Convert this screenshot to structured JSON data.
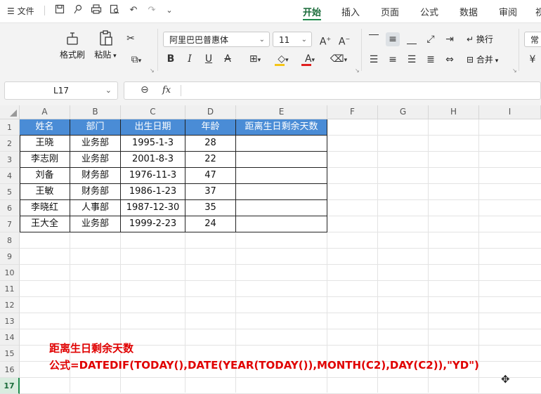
{
  "titlebar": {
    "file_menu": "文件",
    "tabs": [
      "开始",
      "插入",
      "页面",
      "公式",
      "数据",
      "审阅",
      "视"
    ]
  },
  "ribbon": {
    "format_painter": "格式刷",
    "paste": "粘贴",
    "font_name": "阿里巴巴普惠体",
    "font_size": "11",
    "wrap": "换行",
    "merge": "合并",
    "normal": "常",
    "font_color": "#e02020",
    "fill_color": "#f5c518"
  },
  "formula_bar": {
    "name_box": "L17",
    "fx": "fx",
    "formula": ""
  },
  "sheet": {
    "columns": [
      "A",
      "B",
      "C",
      "D",
      "E",
      "F",
      "G",
      "H",
      "I"
    ],
    "rows": [
      "1",
      "2",
      "3",
      "4",
      "5",
      "6",
      "7",
      "8",
      "9",
      "10",
      "11",
      "12",
      "13",
      "14",
      "15",
      "16",
      "17"
    ],
    "selected_row": "17",
    "header": [
      "姓名",
      "部门",
      "出生日期",
      "年龄",
      "距离生日剩余天数"
    ],
    "data": [
      [
        "王晓",
        "业务部",
        "1995-1-3",
        "28",
        ""
      ],
      [
        "李志刚",
        "业务部",
        "2001-8-3",
        "22",
        ""
      ],
      [
        "刘备",
        "财务部",
        "1976-11-3",
        "47",
        ""
      ],
      [
        "王敏",
        "财务部",
        "1986-1-23",
        "37",
        ""
      ],
      [
        "李晓红",
        "人事部",
        "1987-12-30",
        "35",
        ""
      ],
      [
        "王大全",
        "业务部",
        "1999-2-23",
        "24",
        ""
      ]
    ],
    "header_color": "#4a8cd6"
  },
  "annotation": {
    "line1": "距离生日剩余天数",
    "line2": "公式=DATEDIF(TODAY(),DATE(YEAR(TODAY()),MONTH(C2),DAY(C2)),\"YD\")"
  }
}
